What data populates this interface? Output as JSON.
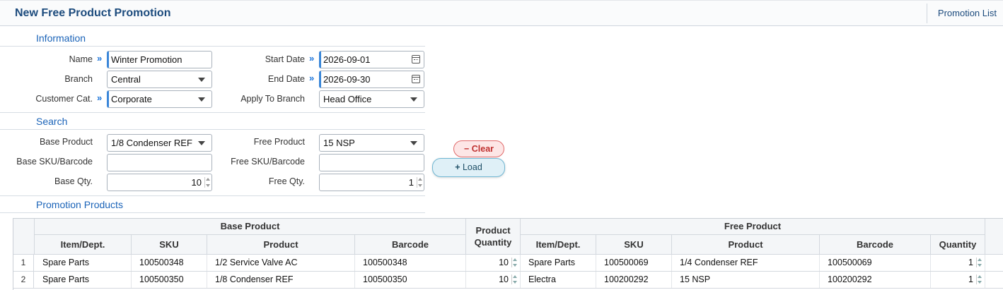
{
  "header": {
    "title": "New Free Product Promotion",
    "promotion_list": "Promotion List"
  },
  "information": {
    "section_title": "Information",
    "name_label": "Name",
    "name_value": "Winter Promotion",
    "branch_label": "Branch",
    "branch_value": "Central",
    "customer_cat_label": "Customer Cat.",
    "customer_cat_value": "Corporate",
    "start_date_label": "Start Date",
    "start_date_value": "2026-09-01",
    "end_date_label": "End Date",
    "end_date_value": "2026-09-30",
    "apply_branch_label": "Apply To Branch",
    "apply_branch_value": "Head Office"
  },
  "search": {
    "section_title": "Search",
    "base_product_label": "Base Product",
    "base_product_value": "1/8 Condenser REF",
    "base_sku_label": "Base SKU/Barcode",
    "base_sku_value": "",
    "base_qty_label": "Base Qty.",
    "base_qty_value": "10",
    "free_product_label": "Free Product",
    "free_product_value": "15 NSP",
    "free_sku_label": "Free SKU/Barcode",
    "free_sku_value": "",
    "free_qty_label": "Free Qty.",
    "free_qty_value": "1",
    "clear_label": "Clear",
    "load_label": "Load"
  },
  "promotion_products": {
    "section_title": "Promotion Products",
    "group_base": "Base Product",
    "group_product_qty": "Product Quantity",
    "group_free": "Free Product",
    "columns": {
      "base_item": "Item/Dept.",
      "base_sku": "SKU",
      "base_product": "Product",
      "base_barcode": "Barcode",
      "free_item": "Item/Dept.",
      "free_sku": "SKU",
      "free_product": "Product",
      "free_barcode": "Barcode",
      "free_qty": "Quantity"
    },
    "rows": [
      {
        "n": "1",
        "base_item": "Spare Parts",
        "base_sku": "100500348",
        "base_product": "1/2 Service Valve AC",
        "base_barcode": "100500348",
        "product_qty": "10",
        "free_item": "Spare Parts",
        "free_sku": "100500069",
        "free_product": "1/4 Condenser REF",
        "free_barcode": "100500069",
        "free_qty": "1"
      },
      {
        "n": "2",
        "base_item": "Spare Parts",
        "base_sku": "100500350",
        "base_product": "1/8 Condenser REF",
        "base_barcode": "100500350",
        "product_qty": "10",
        "free_item": "Electra",
        "free_sku": "100200292",
        "free_product": "15 NSP",
        "free_barcode": "100200292",
        "free_qty": "1"
      }
    ]
  }
}
